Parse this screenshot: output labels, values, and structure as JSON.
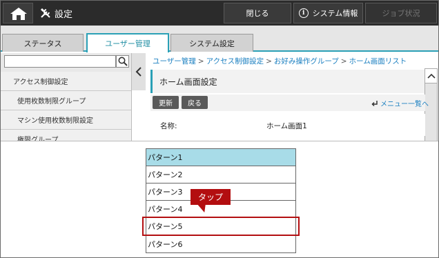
{
  "header": {
    "title": "設定",
    "close_label": "閉じる",
    "sysinfo_label": "システム情報",
    "job_label": "ジョブ状況"
  },
  "tabs": [
    {
      "label": "ステータス"
    },
    {
      "label": "ユーザー管理"
    },
    {
      "label": "システム設定"
    }
  ],
  "sidebar": {
    "search": {
      "value": "",
      "placeholder": ""
    },
    "items": [
      {
        "label": "アクセス制御設定"
      },
      {
        "label": "使用枚数制限グループ"
      },
      {
        "label": "マシン使用枚数制限設定"
      },
      {
        "label": "権限グループ"
      }
    ]
  },
  "breadcrumb": [
    {
      "label": "ユーザー管理"
    },
    {
      "label": "アクセス制御設定"
    },
    {
      "label": "お好み操作グループ"
    },
    {
      "label": "ホーム画面リスト"
    }
  ],
  "breadcrumb_separator": ">",
  "panel": {
    "title": "ホーム画面設定",
    "update_label": "更新",
    "back_label": "戻る",
    "menu_link": "メニュー一覧へ",
    "field_label": "名称:",
    "field_value": "ホーム画面1"
  },
  "dropdown": {
    "options": [
      {
        "label": "パターン1",
        "selected": true
      },
      {
        "label": "パターン2"
      },
      {
        "label": "パターン3"
      },
      {
        "label": "パターン4"
      },
      {
        "label": "パターン5"
      },
      {
        "label": "パターン6"
      }
    ]
  },
  "annotation": {
    "callout_text": "タップ"
  },
  "colors": {
    "accent": "#2aa0b6",
    "selected_option": "#a8dce8",
    "callout": "#b30e10",
    "header_bg": "#2b2b2b"
  }
}
